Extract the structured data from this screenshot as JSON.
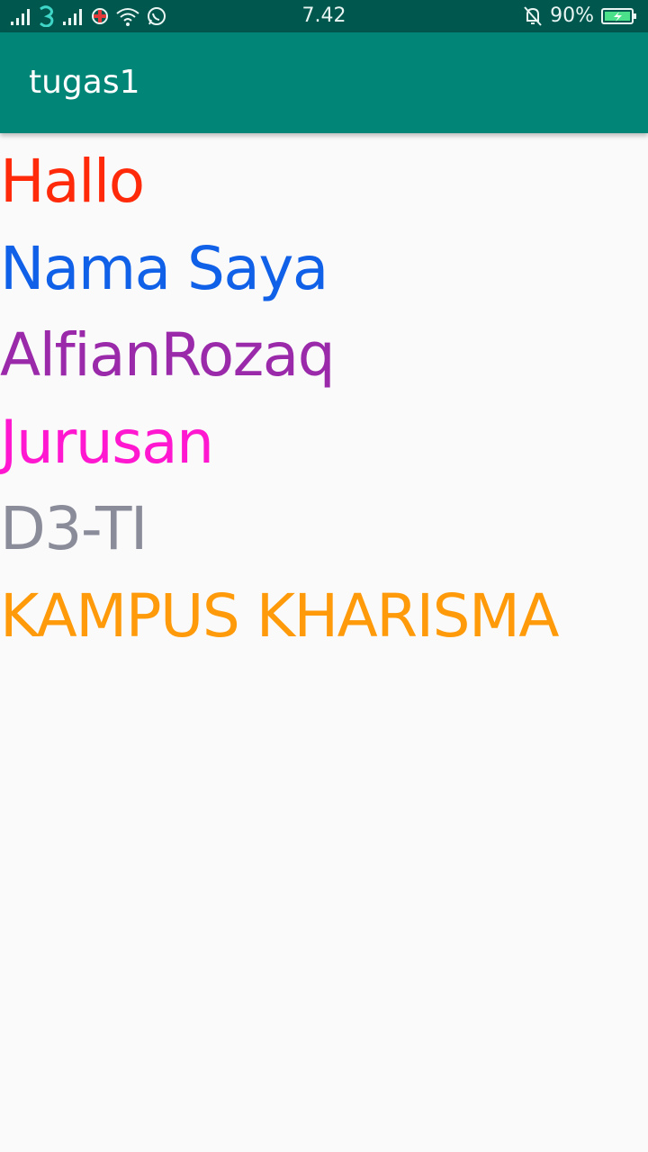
{
  "status_bar": {
    "time": "7.42",
    "battery": "90%",
    "icons": [
      "signal-icon",
      "3-network-icon",
      "signal-icon",
      "data-icon",
      "wifi-icon",
      "whatsapp-icon",
      "mute-bell-icon",
      "battery-charging-icon"
    ]
  },
  "app_bar": {
    "title": "tugas1",
    "color": "#008577"
  },
  "lines": [
    {
      "text": "Hallo",
      "color": "#ff2a0a"
    },
    {
      "text": "Nama Saya",
      "color": "#1060e8"
    },
    {
      "text": "AlfianRozaq",
      "color": "#9a2aaa"
    },
    {
      "text": "Jurusan",
      "color": "#ff18d0"
    },
    {
      "text": "D3-TI",
      "color": "#8a8c9a"
    },
    {
      "text": "KAMPUS KHARISMA",
      "color": "#ff9a0a"
    }
  ]
}
